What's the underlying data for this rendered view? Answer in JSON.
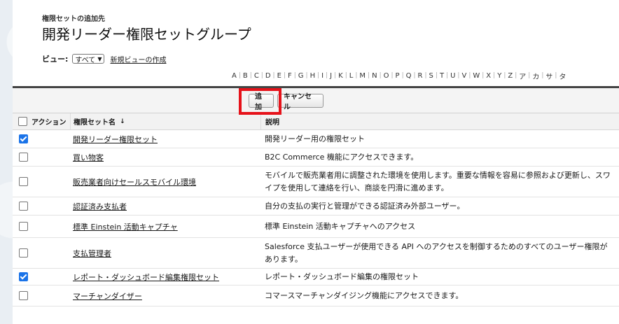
{
  "header": {
    "subtitle": "権限セットの追加先",
    "title": "開発リーダー権限セットグループ"
  },
  "view": {
    "label": "ビュー:",
    "selected": "すべて",
    "new_view_link": "新規ビューの作成"
  },
  "alphabet": [
    "A",
    "B",
    "C",
    "D",
    "E",
    "F",
    "G",
    "H",
    "I",
    "J",
    "K",
    "L",
    "M",
    "N",
    "O",
    "P",
    "Q",
    "R",
    "S",
    "T",
    "U",
    "V",
    "W",
    "X",
    "Y",
    "Z",
    "ア",
    "カ",
    "サ",
    "タ"
  ],
  "buttons": {
    "add": "追加",
    "cancel": "キャンセル"
  },
  "table": {
    "headers": {
      "action": "アクション",
      "name": "権限セット名",
      "sort_indicator": "↓",
      "description": "説明"
    },
    "rows": [
      {
        "checked": true,
        "name": "開発リーダー権限セット",
        "description": "開発リーダー用の権限セット"
      },
      {
        "checked": false,
        "name": "買い物客",
        "description": "B2C Commerce 機能にアクセスできます。"
      },
      {
        "checked": false,
        "name": "販売業者向けセールスモバイル環境",
        "description": "モバイルで販売業者用に調整された環境を使用します。重要な情報を容易に参照および更新し、スワイプを使用して連絡を行い、商談を円滑に進めます。"
      },
      {
        "checked": false,
        "name": "認証済み支払者",
        "description": "自分の支払の実行と管理ができる認証済み外部ユーザー。"
      },
      {
        "checked": false,
        "name": "標準 Einstein 活動キャプチャ",
        "description": "標準 Einstein 活動キャプチャへのアクセス"
      },
      {
        "checked": false,
        "name": "支払管理者",
        "description": "Salesforce 支払ユーザーが使用できる API へのアクセスを制御するためのすべてのユーザー権限があります。"
      },
      {
        "checked": true,
        "name": "レポート・ダッシュボード編集権限セット",
        "description": "レポート・ダッシュボード編集の権限セット"
      },
      {
        "checked": false,
        "name": "マーチャンダイザー",
        "description": "コマースマーチャンダイジング機能にアクセスできます。"
      }
    ]
  },
  "colors": {
    "highlight": "#e6121a",
    "checkbox_checked": "#1a73e8"
  }
}
